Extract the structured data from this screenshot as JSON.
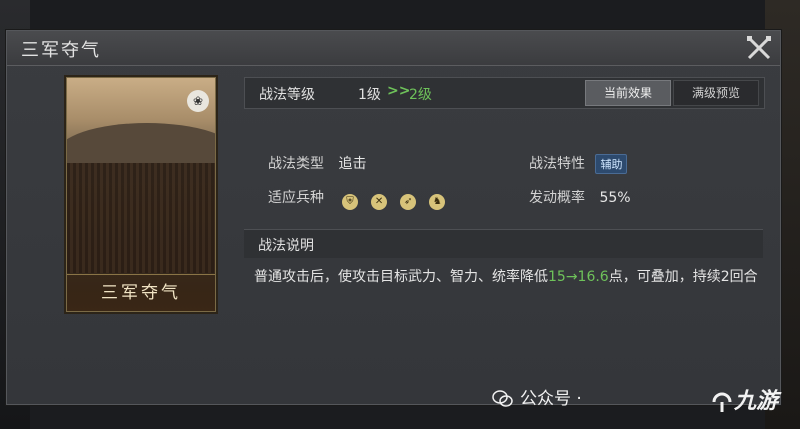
{
  "window": {
    "title": "三军夺气"
  },
  "card": {
    "name": "三军夺气"
  },
  "level": {
    "label": "战法等级",
    "from": "1级",
    "arrow": ">>",
    "to": "2级",
    "tabs": [
      {
        "label": "当前效果",
        "active": true
      },
      {
        "label": "满级预览",
        "active": false
      }
    ]
  },
  "attributes": {
    "type_label": "战法类型",
    "type_value": "追击",
    "trait_label": "战法特性",
    "trait_value": "辅助",
    "troops_label": "适应兵种",
    "troops": [
      "shield-icon",
      "crossbow-icon",
      "spear-icon",
      "horse-icon"
    ],
    "chance_label": "发动概率",
    "chance_value": "55%"
  },
  "description": {
    "heading": "战法说明",
    "text_pre": "普通攻击后，使攻击目标武力、智力、统率降低",
    "text_green": "15→16.6",
    "text_post": "点，可叠加，持续2回合"
  },
  "watermark": {
    "text": "公众号 · ",
    "logo": "九游"
  },
  "colors": {
    "accent_green": "#6ec25a",
    "badge_blue": "#2d4a6e"
  }
}
